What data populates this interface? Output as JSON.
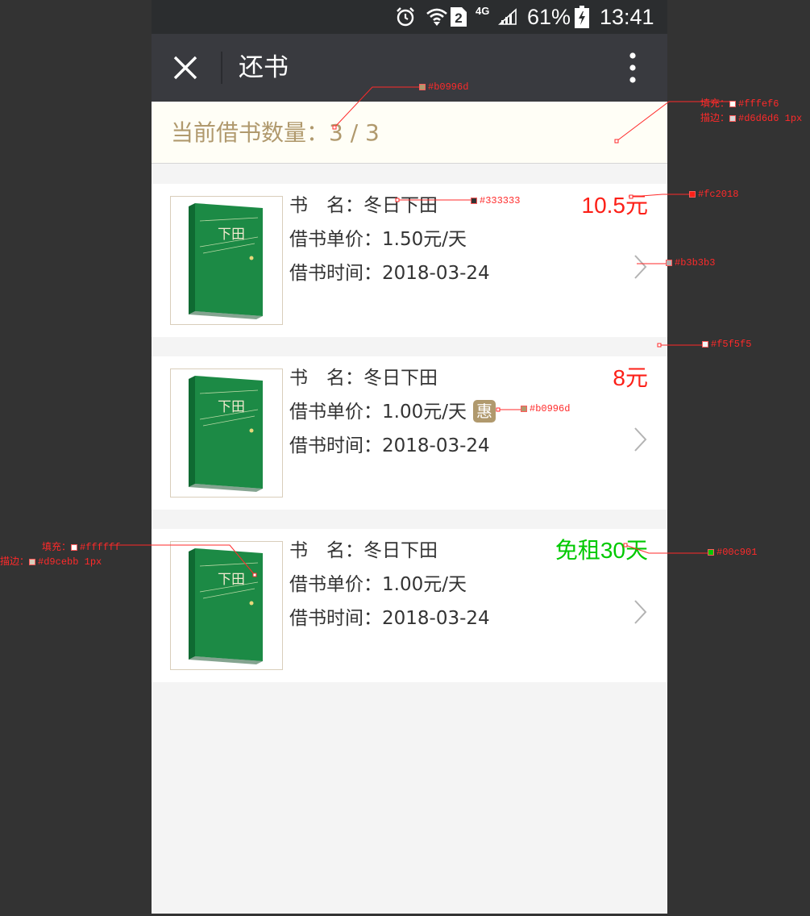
{
  "status_bar": {
    "battery": "61%",
    "time": "13:41",
    "sim_slot": "2",
    "network": "4G",
    "icons": [
      "alarm-icon",
      "wifi-icon",
      "sim-icon",
      "signal-icon",
      "battery-icon"
    ]
  },
  "nav": {
    "title": "还书",
    "close_icon": "close-icon",
    "more_icon": "more-vertical-icon"
  },
  "banner": {
    "text": "当前借书数量：3 / 3"
  },
  "books": [
    {
      "name_label": "书　名：",
      "name": "冬日下田",
      "price_label": "借书单价：",
      "price": "1.50元/天",
      "time_label": "借书时间：",
      "time": "2018-03-24",
      "amount": "10.5元",
      "amount_color": "#fc2018",
      "discount": ""
    },
    {
      "name_label": "书　名：",
      "name": "冬日下田",
      "price_label": "借书单价：",
      "price": "1.00元/天",
      "time_label": "借书时间：",
      "time": "2018-03-24",
      "amount": "8元",
      "amount_color": "#fc2018",
      "discount": "惠"
    },
    {
      "name_label": "书　名：",
      "name": "冬日下田",
      "price_label": "借书单价：",
      "price": "1.00元/天",
      "time_label": "借书时间：",
      "time": "2018-03-24",
      "amount": "免租30天",
      "amount_color": "#00c901",
      "discount": ""
    }
  ],
  "cover_text": "下田",
  "annotations": {
    "a1": "#b0996d",
    "a2_fill_label": "填充：",
    "a2_fill": "#fffef6",
    "a2_stroke_label": "描边：",
    "a2_stroke": "#d6d6d6  1px",
    "a3": "#333333",
    "a4": "#fc2018",
    "a5": "#b3b3b3",
    "a6": "#f5f5f5",
    "a7": "#b0996d",
    "a8_fill_label": "填充：",
    "a8_fill": "#ffffff",
    "a8_stroke_label": "描边：",
    "a8_stroke": "#d9cebb  1px",
    "a9": "#00c901"
  },
  "colors": {
    "accent": "#b0996d",
    "red": "#fc2018",
    "green": "#00c901",
    "text": "#333333",
    "chevron": "#b3b3b3",
    "bg": "#f5f5f5"
  }
}
